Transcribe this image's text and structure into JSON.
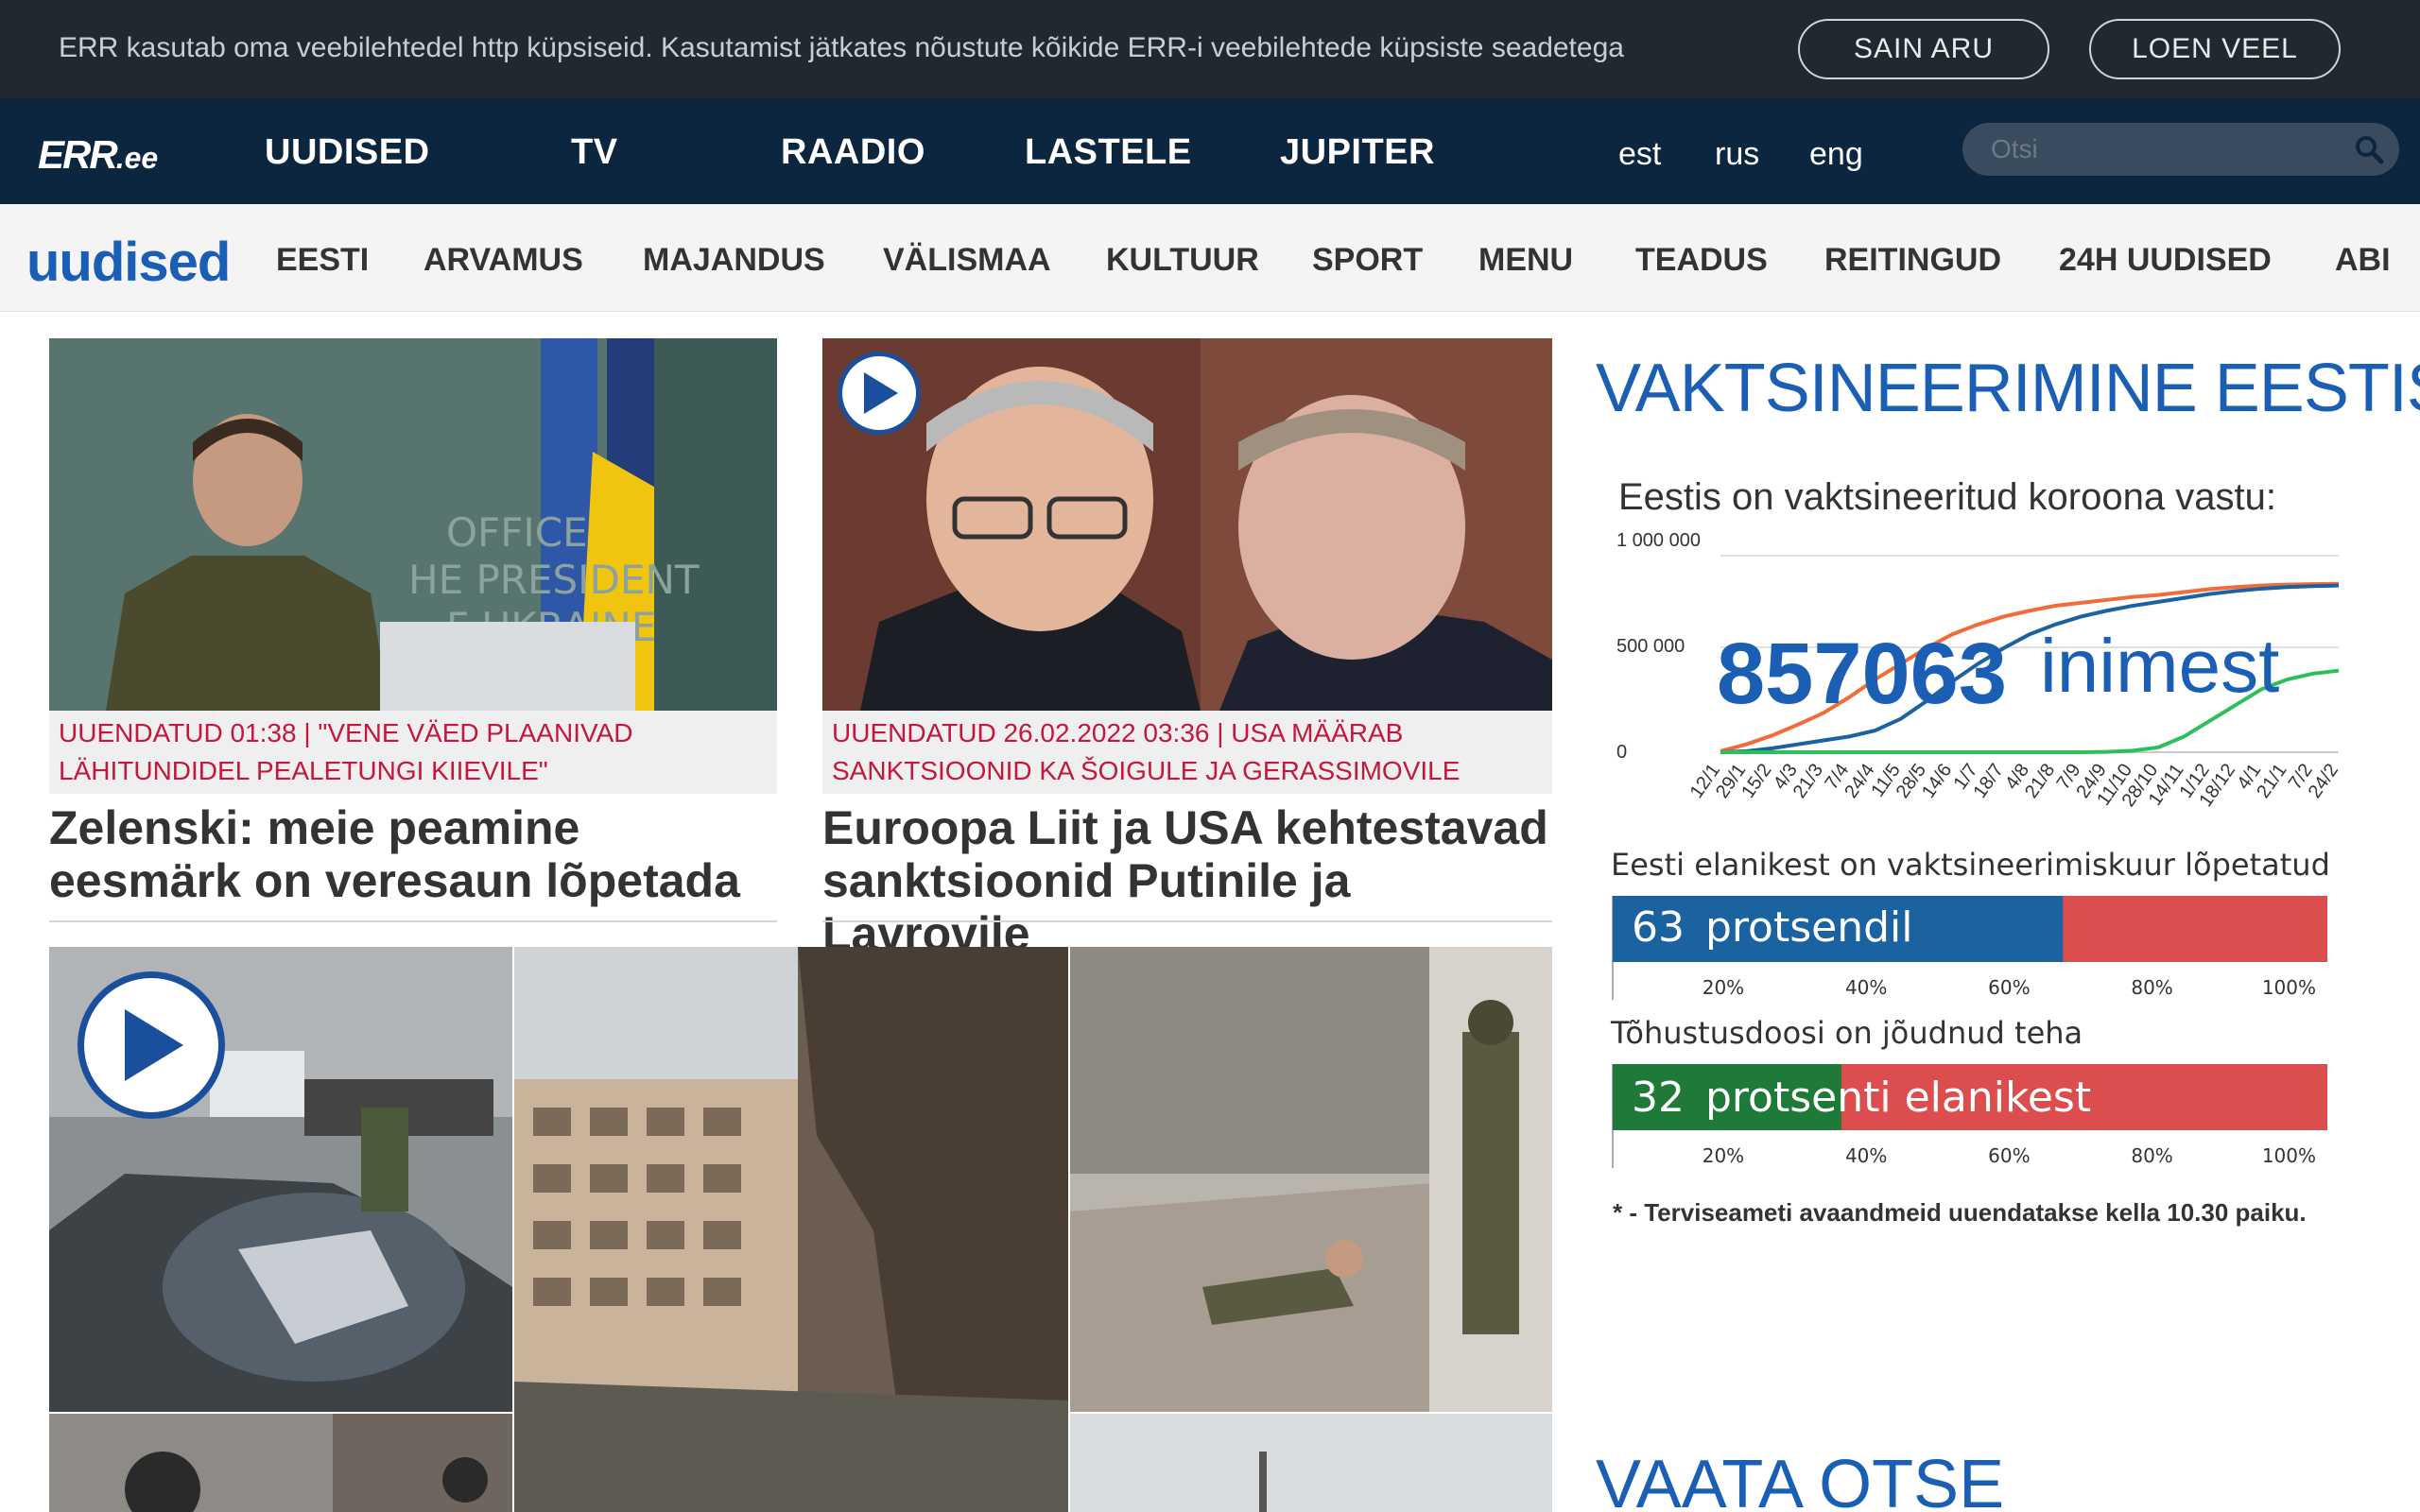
{
  "cookie_bar": {
    "text": "ERR kasutab oma veebilehtedel http küpsiseid. Kasutamist jätkates nõustute kõikide ERR-i veebilehtede küpsiste seadetega",
    "accept_label": "SAIN ARU",
    "more_label": "LOEN VEEL"
  },
  "header": {
    "logo_main": "ERR",
    "logo_suffix": ".ee",
    "nav": [
      "UUDISED",
      "TV",
      "RAADIO",
      "LASTELE",
      "JUPITER"
    ],
    "languages": [
      "est",
      "rus",
      "eng"
    ],
    "search_placeholder": "Otsi"
  },
  "section_nav": {
    "logo": "uudised",
    "items": [
      "EESTI",
      "ARVAMUS",
      "MAJANDUS",
      "VÄLISMAA",
      "KULTUUR",
      "SPORT",
      "MENU",
      "TEADUS",
      "REITINGUD",
      "24H UUDISED",
      "ABI"
    ]
  },
  "articles": [
    {
      "tag": "Uuendatud 01:38 | \"Vene väed plaanivad lähitundidel pealetungi Kiievile\"",
      "title": "Zelenski: meie peamine eesmärk on veresaun lõpetada",
      "has_video": false
    },
    {
      "tag": "Uuendatud 26.02.2022 03:36 | USA määrab sanktsioonid ka Šoigule ja Gerassimovile",
      "title": "Euroopa Liit ja USA kehtestavad sanktsioonid Putinile ja Lavrovile",
      "has_video": true
    }
  ],
  "gallery": {
    "has_video": true
  },
  "sidebar": {
    "vaccination_title": "VAKTSINEERIMINE EESTIS",
    "vaccination_subtitle": "Eestis on vaktsineeritud koroona vastu:",
    "vaccinated_count": "857063",
    "vaccinated_unit": "inimest",
    "completed_label": "Eesti elanikest on vaktsineerimiskuur lõpetatud",
    "completed_value": "63",
    "completed_text": "protsendil",
    "booster_label": "Tõhustusdoosi on jõudnud teha",
    "booster_value": "32",
    "booster_text": "protsenti elanikest",
    "note": "* - Terviseameti avaandmeid uuendatakse kella 10.30 paiku.",
    "live_title": "VAATA OTSE",
    "colors": {
      "blue": "#1a5fb4",
      "bar_blue": "#1a62a0",
      "bar_green": "#1f7a3a",
      "bar_red": "#dc4e4e",
      "line_orange": "#f26b3a",
      "line_green": "#2fbf5a"
    }
  },
  "chart_data": [
    {
      "type": "line",
      "title": "Eestis on vaktsineeritud koroona vastu:",
      "ylabel": "",
      "xlabel": "",
      "ylim": [
        0,
        1000000
      ],
      "y_ticks": [
        "1 000 000",
        "500 000",
        "0"
      ],
      "x": [
        "12/1",
        "29/1",
        "15/2",
        "4/3",
        "21/3",
        "7/4",
        "24/4",
        "11/5",
        "28/5",
        "14/6",
        "1/7",
        "18/7",
        "4/8",
        "21/8",
        "7/9",
        "24/9",
        "11/10",
        "28/10",
        "14/11",
        "1/12",
        "18/12",
        "4/1",
        "21/1",
        "7/2",
        "24/2"
      ],
      "series": [
        {
          "color": "#f26b3a",
          "values": [
            5000,
            40000,
            85000,
            140000,
            200000,
            280000,
            370000,
            450000,
            530000,
            600000,
            650000,
            690000,
            720000,
            745000,
            760000,
            775000,
            790000,
            800000,
            815000,
            830000,
            840000,
            848000,
            853000,
            855000,
            857063
          ]
        },
        {
          "color": "#1a62a0",
          "values": [
            0,
            5000,
            20000,
            40000,
            60000,
            80000,
            110000,
            170000,
            260000,
            360000,
            450000,
            530000,
            600000,
            650000,
            690000,
            720000,
            745000,
            765000,
            785000,
            805000,
            820000,
            832000,
            840000,
            845000,
            848000
          ]
        },
        {
          "color": "#2fbf5a",
          "values": [
            0,
            0,
            0,
            0,
            0,
            0,
            0,
            0,
            0,
            0,
            0,
            0,
            0,
            0,
            0,
            2000,
            8000,
            25000,
            80000,
            160000,
            240000,
            320000,
            370000,
            400000,
            415000
          ]
        }
      ],
      "annotation": "857063 inimest"
    },
    {
      "type": "bar",
      "title": "Eesti elanikest on vaktsineerimiskuur lõpetatud",
      "values": [
        63
      ],
      "x_ticks": [
        "20%",
        "40%",
        "60%",
        "80%",
        "100%"
      ],
      "ylim": [
        0,
        100
      ]
    },
    {
      "type": "bar",
      "title": "Tõhustusdoosi on jõudnud teha",
      "values": [
        32
      ],
      "x_ticks": [
        "20%",
        "40%",
        "60%",
        "80%",
        "100%"
      ],
      "ylim": [
        0,
        100
      ]
    }
  ]
}
